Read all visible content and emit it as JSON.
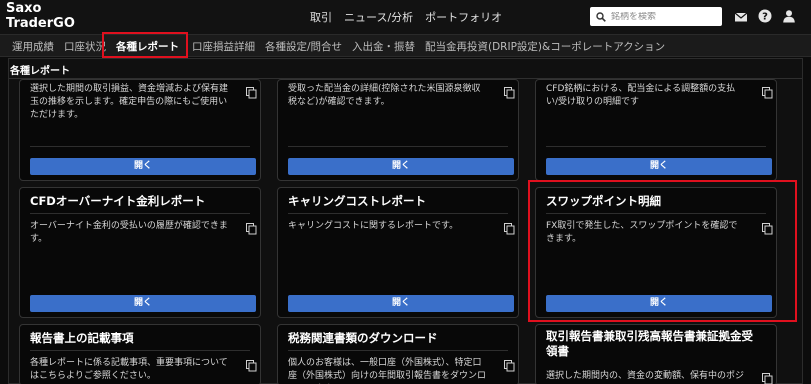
{
  "header": {
    "logo_line1": "Saxo",
    "logo_line2": "TraderGO",
    "nav": [
      "取引",
      "ニュース/分析",
      "ポートフォリオ"
    ],
    "search_placeholder": "銘柄を検索",
    "icons": [
      "mail-icon",
      "help-icon",
      "user-icon"
    ]
  },
  "tabs": [
    {
      "label": "運用成績",
      "active": false
    },
    {
      "label": "口座状況",
      "active": false
    },
    {
      "label": "各種レポート",
      "active": true
    },
    {
      "label": "口座損益詳細",
      "active": false
    },
    {
      "label": "各種設定/問合せ",
      "active": false
    },
    {
      "label": "入出金・振替",
      "active": false
    },
    {
      "label": "配当金再投資(DRIP設定)&コーポレートアクション",
      "active": false
    }
  ],
  "section": {
    "title": "各種レポート"
  },
  "colors": {
    "accent_button": "#3a6fc9",
    "highlight": "#e0101e",
    "background": "#0c0c0c"
  },
  "cards": [
    {
      "title": "",
      "desc": "選択した期間の取引損益、資金増減および保有建玉の推移を示します。確定申告の際にもご使用いただけます。",
      "button": "開く"
    },
    {
      "title": "",
      "desc": "受取った配当金の詳細(控除された米国源泉徴収税など)が確認できます。",
      "button": "開く"
    },
    {
      "title": "",
      "desc": "CFD銘柄における、配当金による調整額の支払い/受け取りの明細です",
      "button": "開く"
    },
    {
      "title": "CFDオーバーナイト金利レポート",
      "desc": "オーバーナイト金利の受払いの履歴が確認できます。",
      "button": "開く"
    },
    {
      "title": "キャリングコストレポート",
      "desc": "キャリングコストに関するレポートです。",
      "button": "開く"
    },
    {
      "title": "スワップポイント明細",
      "desc": "FX取引で発生した、スワップポイントを確認できます。",
      "button": "開く"
    },
    {
      "title": "報告書上の記載事項",
      "desc": "各種レポートに係る記載事項、重要事項についてはこちらよりご参照ください。",
      "button": ""
    },
    {
      "title": "税務関連書類のダウンロード",
      "desc": "個人のお客様は、一般口座（外国株式）、特定口座（外国株式）向けの年間取引報告書をダウンロードできま",
      "button": ""
    },
    {
      "title": "取引報告書兼取引残高報告書兼証拠金受領書",
      "desc": "選択した期間内の、資金の変動額、保有中のポジシ",
      "button": ""
    }
  ]
}
